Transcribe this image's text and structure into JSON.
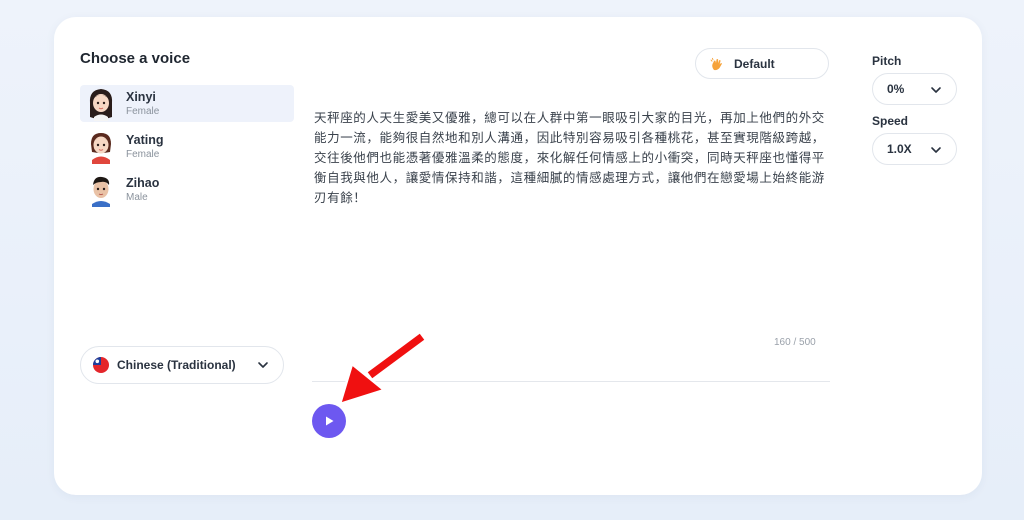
{
  "voice_panel": {
    "title": "Choose a voice",
    "voices": [
      {
        "name": "Xinyi",
        "gender": "Female",
        "selected": true
      },
      {
        "name": "Yating",
        "gender": "Female",
        "selected": false
      },
      {
        "name": "Zihao",
        "gender": "Male",
        "selected": false
      }
    ],
    "language": "Chinese (Traditional)"
  },
  "style": {
    "label": "Default"
  },
  "editor": {
    "text": "天秤座的人天生愛美又優雅，總可以在人群中第一眼吸引大家的目光，再加上他們的外交能力一流，能夠很自然地和別人溝通，因此特別容易吸引各種桃花，甚至實現階級跨越，交往後他們也能憑著優雅溫柔的態度，來化解任何情感上的小衝突，同時天秤座也懂得平衡自我與他人，讓愛情保持和諧，這種細膩的情感處理方式，讓他們在戀愛場上始終能游刃有餘！",
    "char_count": "160 / 500"
  },
  "controls": {
    "pitch": {
      "label": "Pitch",
      "value": "0%"
    },
    "speed": {
      "label": "Speed",
      "value": "1.0X"
    }
  },
  "colors": {
    "accent": "#6d58f0",
    "annotation_arrow": "#f01010",
    "selected_bg": "#eef2fb"
  },
  "icons": {
    "play": "play-icon",
    "chevron": "chevron-down-icon",
    "flag": "taiwan-flag-icon",
    "style": "hand-wave-icon"
  }
}
